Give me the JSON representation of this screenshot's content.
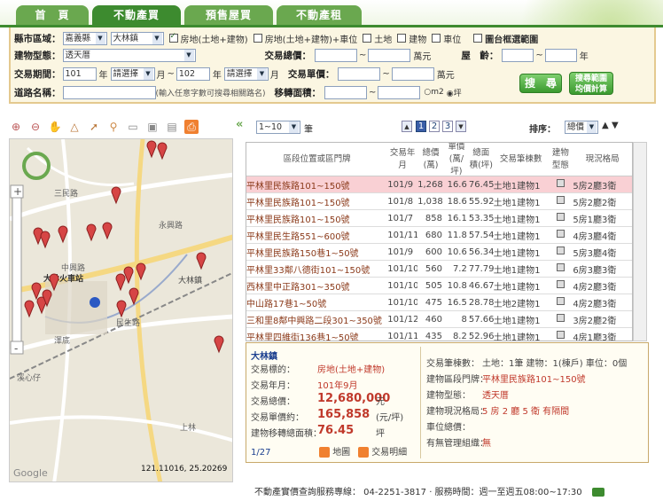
{
  "tabs": [
    "首　頁",
    "不動產買賣",
    "預售屋買賣",
    "不動產租賃"
  ],
  "search": {
    "county_label": "縣市區域：",
    "county_value": "嘉義縣",
    "town_value": "大林鎮",
    "type_opts": [
      "房地(土地+建物)",
      "房地(土地+建物)+車位",
      "土地",
      "建物",
      "車位"
    ],
    "map_select_label": "圖台框選範圍",
    "building_label": "建物型態：",
    "building_value": "透天厝",
    "total_label": "交易總價：",
    "total_unit": "萬元",
    "age_label": "屋　齡：",
    "age_unit": "年",
    "period_label": "交易期間：",
    "from_year": "101",
    "year_unit": "年",
    "month_placeholder": "請選擇",
    "month_unit": "月",
    "tilde": "~",
    "to_year": "102",
    "unit_price_label": "交易單價：",
    "unit_price_unit": "萬元",
    "road_label": "道路名稱：",
    "road_hint": "(輸入任意字數可搜尋相關路名)",
    "area_label": "移轉面積：",
    "unit_m2": "m2",
    "unit_ping": "坪",
    "search_btn": "搜　尋",
    "range_btn_1": "搜尋範圍",
    "range_btn_2": "均價計算"
  },
  "map": {
    "coords": "121.11016, 25.20269",
    "google": "Google",
    "labels": [
      "三民路",
      "大林火車站",
      "中興路",
      "大林鎮",
      "民生路",
      "澤底",
      "溪心仔",
      "上林",
      "永興路"
    ]
  },
  "pagination": {
    "rows_value": "1~10",
    "rows_unit": "筆",
    "pages": [
      "1",
      "2",
      "3"
    ],
    "sort_label": "排序：",
    "sort_value": "總價"
  },
  "grid": {
    "headers": [
      "區段位置或區門牌",
      "交易年月",
      "總價(萬)",
      "單價(萬/坪)",
      "總面積(坪)",
      "交易筆棟數",
      "建物型態",
      "現況格局"
    ],
    "rows": [
      [
        "平林里民族路101~150號",
        "101/9",
        "1,268",
        "16.6",
        "76.45",
        "土地1建物1",
        "",
        "5房2廳3衛"
      ],
      [
        "平林里民族路101~150號",
        "101/8",
        "1,038",
        "18.6",
        "55.92",
        "土地1建物1",
        "",
        "5房2廳2衛"
      ],
      [
        "平林里民族路101~150號",
        "101/7",
        "858",
        "16.1",
        "53.35",
        "土地1建物1",
        "",
        "5房1廳3衛"
      ],
      [
        "平林里民生路551~600號",
        "101/11",
        "680",
        "11.8",
        "57.54",
        "土地1建物1",
        "",
        "4房3廳4衛"
      ],
      [
        "平林里民族路150巷1~50號",
        "101/9",
        "600",
        "10.6",
        "56.34",
        "土地1建物1",
        "",
        "5房3廳4衛"
      ],
      [
        "平林里33鄰八德街101~150號",
        "101/10",
        "560",
        "7.2",
        "77.79",
        "土地1建物1",
        "",
        "6房3廳3衛"
      ],
      [
        "西林里中正路301~350號",
        "101/10",
        "505",
        "10.8",
        "46.67",
        "土地1建物1",
        "",
        "4房2廳3衛"
      ],
      [
        "中山路17巷1~50號",
        "101/10",
        "475",
        "16.5",
        "28.78",
        "土地2建物1",
        "",
        "4房2廳3衛"
      ],
      [
        "三和里8鄰中興路二段301~350號",
        "101/12",
        "460",
        "8",
        "57.66",
        "土地1建物1",
        "",
        "3房2廳2衛"
      ],
      [
        "平林里四維街136巷1~50號",
        "101/11",
        "435",
        "8.2",
        "52.96",
        "土地1建物1",
        "",
        "4房1廳3衛"
      ]
    ]
  },
  "detail": {
    "town": "大林鎮",
    "count": "1/27",
    "l1": "交易標的：",
    "v1": "房地(土地+建物)",
    "l2": "交易年月：",
    "v2": "101年9月",
    "l3": "交易總價：",
    "v3": "12,680,000",
    "u3": "元",
    "l4": "交易單價約：",
    "v4": "165,858",
    "u4": "(元/坪)",
    "l5": "建物移轉總面積：",
    "v5": "76.45",
    "u5": "坪",
    "map_link": "地圖",
    "tx_link": "交易明細",
    "r1": "交易筆棟數：",
    "r1v": "土地：1筆 建物：1(棟戶) 車位：0個",
    "r2": "建物區段門牌：",
    "r2v": "平林里民族路101~150號",
    "r3": "建物型態：",
    "r3v": "透天厝",
    "r4": "建物現況格局：",
    "r4v": "5 房 2 廳 5 衛 有隔間",
    "r5": "車位總價：",
    "r5v": "",
    "r6": "有無管理組織：",
    "r6v": "無"
  },
  "footer": "不動產實價查詢服務專線：  04-2251-3817 · 服務時間：週一至週五08:00~17:30",
  "colors": {
    "brand": "#3d8b2f",
    "pin": "#d64545",
    "selected_row": "#f9d0d4"
  }
}
